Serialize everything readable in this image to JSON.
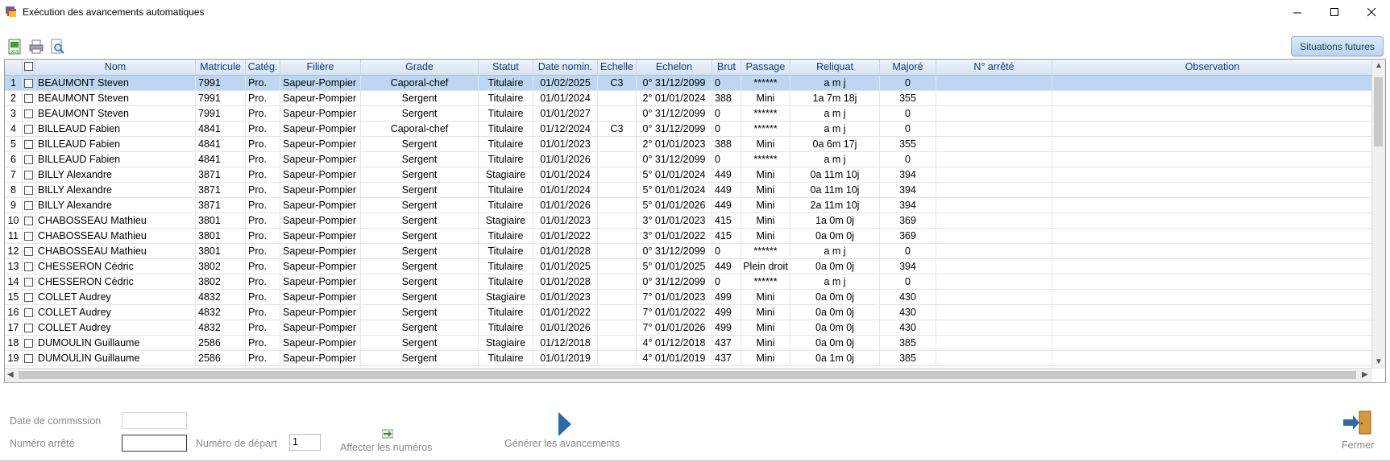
{
  "window": {
    "title": "Exécution des avancements automatiques"
  },
  "toolbar": {
    "situations_label": "Situations futures"
  },
  "icons": [
    "excel-icon",
    "print-icon",
    "print-preview-icon",
    "app-icon",
    "affecter-icon",
    "generate-arrow-icon",
    "exit-door-icon"
  ],
  "colors": {
    "header_text": "#0a3d8a",
    "selected_row": "#bdd7f3",
    "accent": "#2d6aa8"
  },
  "table": {
    "columns": [
      "",
      "",
      "Nom",
      "Matricule",
      "Catég.",
      "Filière",
      "Grade",
      "Statut",
      "Date nomin.",
      "Echelle",
      "Echelon",
      "Brut",
      "Passage",
      "Reliquat",
      "Majoré",
      "N° arrêté",
      "Observation"
    ],
    "rows": [
      {
        "n": "1",
        "nom": "BEAUMONT Steven",
        "mat": "7991",
        "cat": "Pro.",
        "fil": "Sapeur-Pompier",
        "grade": "Caporal-chef",
        "statut": "Titulaire",
        "date": "01/02/2025",
        "echelle": "C3",
        "echelon": "0° 31/12/2099",
        "brut": "0",
        "passage": "******",
        "reliquat": "a m j",
        "majore": "0",
        "selected": true
      },
      {
        "n": "2",
        "nom": "BEAUMONT Steven",
        "mat": "7991",
        "cat": "Pro.",
        "fil": "Sapeur-Pompier",
        "grade": "Sergent",
        "statut": "Titulaire",
        "date": "01/01/2024",
        "echelle": "",
        "echelon": "2° 01/01/2024",
        "brut": "388",
        "passage": "Mini",
        "reliquat": "1a  7m 18j",
        "majore": "355"
      },
      {
        "n": "3",
        "nom": "BEAUMONT Steven",
        "mat": "7991",
        "cat": "Pro.",
        "fil": "Sapeur-Pompier",
        "grade": "Sergent",
        "statut": "Titulaire",
        "date": "01/01/2027",
        "echelle": "",
        "echelon": "0° 31/12/2099",
        "brut": "0",
        "passage": "******",
        "reliquat": "a m j",
        "majore": "0"
      },
      {
        "n": "4",
        "nom": "BILLEAUD Fabien",
        "mat": "4841",
        "cat": "Pro.",
        "fil": "Sapeur-Pompier",
        "grade": "Caporal-chef",
        "statut": "Titulaire",
        "date": "01/12/2024",
        "echelle": "C3",
        "echelon": "0° 31/12/2099",
        "brut": "0",
        "passage": "******",
        "reliquat": "a m j",
        "majore": "0"
      },
      {
        "n": "5",
        "nom": "BILLEAUD Fabien",
        "mat": "4841",
        "cat": "Pro.",
        "fil": "Sapeur-Pompier",
        "grade": "Sergent",
        "statut": "Titulaire",
        "date": "01/01/2023",
        "echelle": "",
        "echelon": "2° 01/01/2023",
        "brut": "388",
        "passage": "Mini",
        "reliquat": "0a  6m 17j",
        "majore": "355"
      },
      {
        "n": "6",
        "nom": "BILLEAUD Fabien",
        "mat": "4841",
        "cat": "Pro.",
        "fil": "Sapeur-Pompier",
        "grade": "Sergent",
        "statut": "Titulaire",
        "date": "01/01/2026",
        "echelle": "",
        "echelon": "0° 31/12/2099",
        "brut": "0",
        "passage": "******",
        "reliquat": "a m j",
        "majore": "0"
      },
      {
        "n": "7",
        "nom": "BILLY Alexandre",
        "mat": "3871",
        "cat": "Pro.",
        "fil": "Sapeur-Pompier",
        "grade": "Sergent",
        "statut": "Stagiaire",
        "date": "01/01/2024",
        "echelle": "",
        "echelon": "5° 01/01/2024",
        "brut": "449",
        "passage": "Mini",
        "reliquat": "0a 11m 10j",
        "majore": "394"
      },
      {
        "n": "8",
        "nom": "BILLY Alexandre",
        "mat": "3871",
        "cat": "Pro.",
        "fil": "Sapeur-Pompier",
        "grade": "Sergent",
        "statut": "Titulaire",
        "date": "01/01/2024",
        "echelle": "",
        "echelon": "5° 01/01/2024",
        "brut": "449",
        "passage": "Mini",
        "reliquat": "0a 11m 10j",
        "majore": "394"
      },
      {
        "n": "9",
        "nom": "BILLY Alexandre",
        "mat": "3871",
        "cat": "Pro.",
        "fil": "Sapeur-Pompier",
        "grade": "Sergent",
        "statut": "Titulaire",
        "date": "01/01/2026",
        "echelle": "",
        "echelon": "5° 01/01/2026",
        "brut": "449",
        "passage": "Mini",
        "reliquat": "2a 11m 10j",
        "majore": "394"
      },
      {
        "n": "10",
        "nom": "CHABOSSEAU Mathieu",
        "mat": "3801",
        "cat": "Pro.",
        "fil": "Sapeur-Pompier",
        "grade": "Sergent",
        "statut": "Stagiaire",
        "date": "01/01/2023",
        "echelle": "",
        "echelon": "3° 01/01/2023",
        "brut": "415",
        "passage": "Mini",
        "reliquat": "1a  0m  0j",
        "majore": "369"
      },
      {
        "n": "11",
        "nom": "CHABOSSEAU Mathieu",
        "mat": "3801",
        "cat": "Pro.",
        "fil": "Sapeur-Pompier",
        "grade": "Sergent",
        "statut": "Titulaire",
        "date": "01/01/2022",
        "echelle": "",
        "echelon": "3° 01/01/2022",
        "brut": "415",
        "passage": "Mini",
        "reliquat": "0a  0m  0j",
        "majore": "369"
      },
      {
        "n": "12",
        "nom": "CHABOSSEAU Mathieu",
        "mat": "3801",
        "cat": "Pro.",
        "fil": "Sapeur-Pompier",
        "grade": "Sergent",
        "statut": "Titulaire",
        "date": "01/01/2028",
        "echelle": "",
        "echelon": "0° 31/12/2099",
        "brut": "0",
        "passage": "******",
        "reliquat": "a m j",
        "majore": "0"
      },
      {
        "n": "13",
        "nom": "CHESSERON Cédric",
        "mat": "3802",
        "cat": "Pro.",
        "fil": "Sapeur-Pompier",
        "grade": "Sergent",
        "statut": "Titulaire",
        "date": "01/01/2025",
        "echelle": "",
        "echelon": "5° 01/01/2025",
        "brut": "449",
        "passage": "Plein droit",
        "reliquat": "0a  0m  0j",
        "majore": "394"
      },
      {
        "n": "14",
        "nom": "CHESSERON Cédric",
        "mat": "3802",
        "cat": "Pro.",
        "fil": "Sapeur-Pompier",
        "grade": "Sergent",
        "statut": "Titulaire",
        "date": "01/01/2028",
        "echelle": "",
        "echelon": "0° 31/12/2099",
        "brut": "0",
        "passage": "******",
        "reliquat": "a m j",
        "majore": "0"
      },
      {
        "n": "15",
        "nom": "COLLET Audrey",
        "mat": "4832",
        "cat": "Pro.",
        "fil": "Sapeur-Pompier",
        "grade": "Sergent",
        "statut": "Stagiaire",
        "date": "01/01/2023",
        "echelle": "",
        "echelon": "7° 01/01/2023",
        "brut": "499",
        "passage": "Mini",
        "reliquat": "0a  0m  0j",
        "majore": "430"
      },
      {
        "n": "16",
        "nom": "COLLET Audrey",
        "mat": "4832",
        "cat": "Pro.",
        "fil": "Sapeur-Pompier",
        "grade": "Sergent",
        "statut": "Titulaire",
        "date": "01/01/2022",
        "echelle": "",
        "echelon": "7° 01/01/2022",
        "brut": "499",
        "passage": "Mini",
        "reliquat": "0a  0m  0j",
        "majore": "430"
      },
      {
        "n": "17",
        "nom": "COLLET Audrey",
        "mat": "4832",
        "cat": "Pro.",
        "fil": "Sapeur-Pompier",
        "grade": "Sergent",
        "statut": "Titulaire",
        "date": "01/01/2026",
        "echelle": "",
        "echelon": "7° 01/01/2026",
        "brut": "499",
        "passage": "Mini",
        "reliquat": "0a  0m  0j",
        "majore": "430"
      },
      {
        "n": "18",
        "nom": "DUMOULIN Guillaume",
        "mat": "2586",
        "cat": "Pro.",
        "fil": "Sapeur-Pompier",
        "grade": "Sergent",
        "statut": "Stagiaire",
        "date": "01/12/2018",
        "echelle": "",
        "echelon": "4° 01/12/2018",
        "brut": "437",
        "passage": "Mini",
        "reliquat": "0a  0m  0j",
        "majore": "385"
      },
      {
        "n": "19",
        "nom": "DUMOULIN Guillaume",
        "mat": "2586",
        "cat": "Pro.",
        "fil": "Sapeur-Pompier",
        "grade": "Sergent",
        "statut": "Titulaire",
        "date": "01/01/2019",
        "echelle": "",
        "echelon": "4° 01/01/2019",
        "brut": "437",
        "passage": "Mini",
        "reliquat": "0a  1m  0j",
        "majore": "385"
      }
    ]
  },
  "form": {
    "date_commission_label": "Date de commission",
    "date_commission_value": "",
    "numero_arrete_label": "Numéro arrêté",
    "numero_arrete_value": "",
    "numero_depart_label": "Numéro de départ",
    "numero_depart_value": "1",
    "affecter_label": "Affecter les numéros",
    "generer_label": "Générer les avancements",
    "fermer_label": "Fermer"
  }
}
